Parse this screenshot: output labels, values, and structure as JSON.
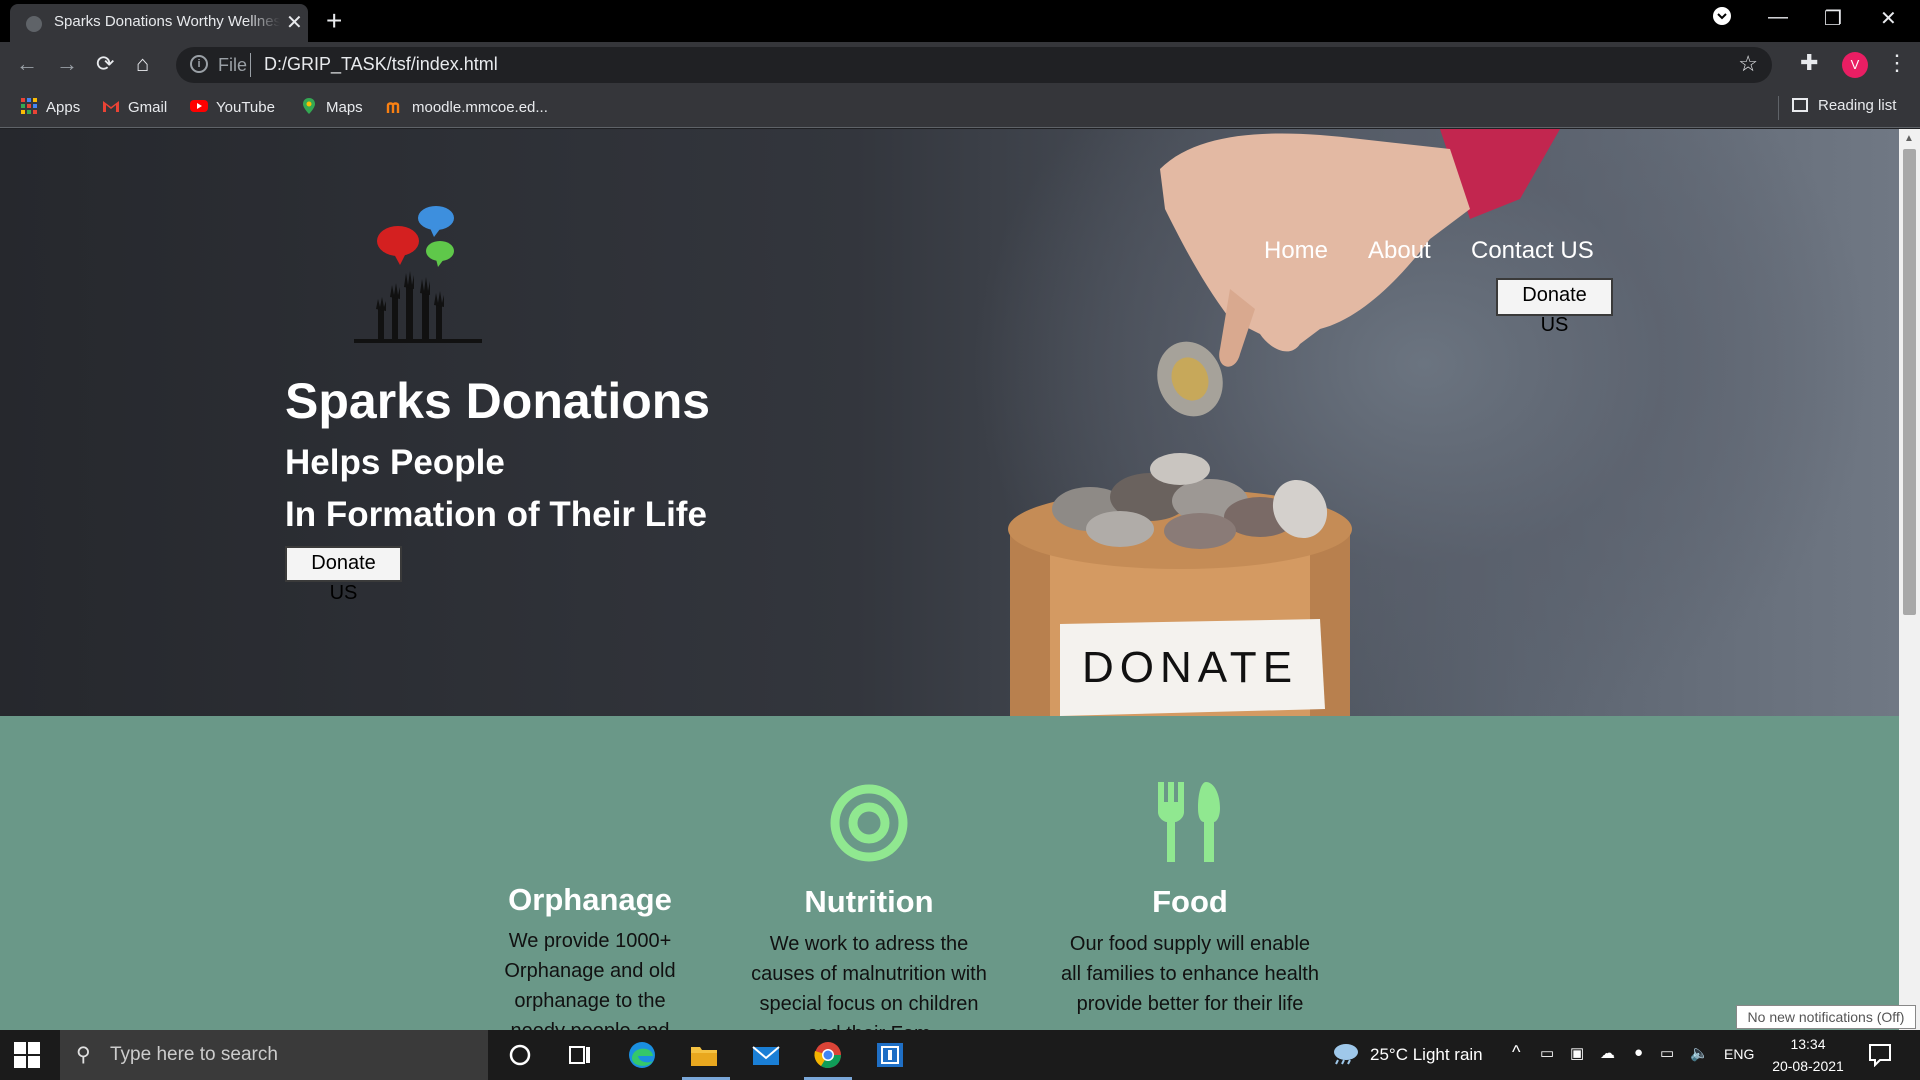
{
  "browser": {
    "tab_title": "Sparks Donations Worthy Wellness",
    "url_scheme": "File",
    "url": "D:/GRIP_TASK/tsf/index.html",
    "profile_initial": "V",
    "bookmarks": [
      {
        "label": "Apps",
        "icon": "apps-grid-icon"
      },
      {
        "label": "Gmail",
        "icon": "gmail-icon"
      },
      {
        "label": "YouTube",
        "icon": "youtube-icon"
      },
      {
        "label": "Maps",
        "icon": "maps-icon"
      },
      {
        "label": "moodle.mmcoe.ed...",
        "icon": "moodle-icon"
      }
    ],
    "reading_list": "Reading list"
  },
  "hero": {
    "title": "Sparks Donations",
    "subtitle_1": "Helps People",
    "subtitle_2": "In Formation of Their Life",
    "donate_label": "Donate US",
    "jar_label": "DONATE"
  },
  "nav": {
    "home": "Home",
    "about": "About",
    "contact": "Contact US",
    "donate_label": "Donate US"
  },
  "features": [
    {
      "icon": "orphanage-icon",
      "title": "Orphanage",
      "lines": [
        "We provide 1000+",
        "Orphanage and old",
        "orphanage to the",
        "needy people and"
      ]
    },
    {
      "icon": "target-icon",
      "title": "Nutrition",
      "lines": [
        "We work to adress the",
        "causes of malnutrition with",
        "special focus on children",
        "and their Fam"
      ]
    },
    {
      "icon": "fork-spoon-icon",
      "title": "Food",
      "lines": [
        "Our food supply will enable",
        "all families to enhance health",
        "provide better for their life"
      ]
    }
  ],
  "notification_toast": "No new notifications (Off)",
  "taskbar": {
    "search_placeholder": "Type here to search",
    "weather": "25°C  Light rain",
    "language": "ENG",
    "time": "13:34",
    "date": "20-08-2021"
  },
  "colors": {
    "feature_bg": "#6a9888",
    "icon_green": "#90e890",
    "hero_bg": "#2d3036"
  }
}
